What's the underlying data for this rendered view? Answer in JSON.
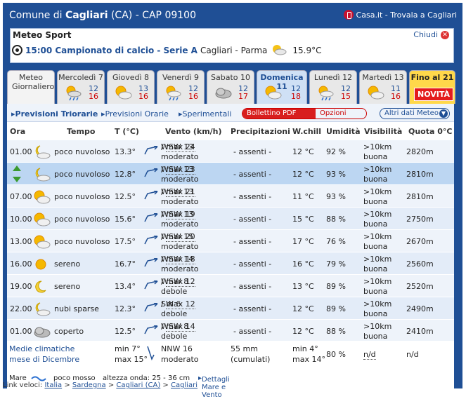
{
  "header": {
    "prefix": "Comune di ",
    "city": "Cagliari",
    "province": " (CA) - CAP 09100",
    "casa_link": "Casa.it - Trovala a Cagliari"
  },
  "sport": {
    "title": "Meteo Sport",
    "close_label": "Chiudi",
    "time_event": "15:00 Campionato di calcio - Serie A",
    "teams": "Cagliari - Parma",
    "temp": "15.9°C"
  },
  "tabs": [
    {
      "label": "Meteo Giornaliero",
      "type": "gior"
    },
    {
      "label": "Mercoledì 7",
      "min": "12",
      "max": "16",
      "icon": "cloud-sun-rain-icon"
    },
    {
      "label": "Giovedì 8",
      "min": "13",
      "max": "16",
      "icon": "sun-cloud-icon"
    },
    {
      "label": "Venerdì 9",
      "min": "12",
      "max": "16",
      "icon": "sun-cloud-rain-icon"
    },
    {
      "label": "Sabato 10",
      "min": "12",
      "max": "17",
      "icon": "cloud-icon"
    },
    {
      "label": "Domenica 11",
      "min": "12",
      "max": "18",
      "icon": "sun-cloud-icon",
      "type": "dom"
    },
    {
      "label": "Lunedì 12",
      "min": "12",
      "max": "15",
      "icon": "sun-cloud-rain-icon"
    },
    {
      "label": "Martedì 13",
      "min": "11",
      "max": "16",
      "icon": "sun-cloud-icon"
    },
    {
      "label": "Fino al 21",
      "badge": "NOVITÀ",
      "type": "fino"
    }
  ],
  "subnav": {
    "items": [
      "Previsioni Triorarie",
      "Previsioni Orarie",
      "Sperimentali"
    ],
    "pdf": "Bollettino PDF",
    "opzioni": "Opzioni",
    "altri": "Altri dati Meteo"
  },
  "columns": [
    "Ora",
    "Tempo",
    "T (°C)",
    "Vento (km/h)",
    "Precipitazioni",
    "W.chill",
    "Umidità",
    "Visibilità",
    "Quota 0°C"
  ],
  "rows": [
    {
      "ora": "01.00",
      "icon": "moon-cloud-icon",
      "tempo": "poco nuvoloso",
      "temp": "13.3°",
      "wind": "WSW 13",
      "wind_max": "max 24",
      "wind_desc": "moderato",
      "prec": "- assenti -",
      "wc": "12 °C",
      "um": "92 %",
      "vis": ">10km",
      "vis_desc": "buona",
      "quota": "2820m"
    },
    {
      "ora": "04.00",
      "icon": "moon-cloud-icon",
      "tempo": "poco nuvoloso",
      "temp": "12.8°",
      "wind": "WSW 13",
      "wind_max": "max 23",
      "wind_desc": "moderato",
      "prec": "- assenti -",
      "wc": "12 °C",
      "um": "93 %",
      "vis": ">10km",
      "vis_desc": "buona",
      "quota": "2810m"
    },
    {
      "ora": "07.00",
      "icon": "sun-cloud-icon",
      "tempo": "poco nuvoloso",
      "temp": "12.5°",
      "wind": "WSW 13",
      "wind_max": "max 21",
      "wind_desc": "moderato",
      "prec": "- assenti -",
      "wc": "11 °C",
      "um": "93 %",
      "vis": ">10km",
      "vis_desc": "buona",
      "quota": "2810m"
    },
    {
      "ora": "10.00",
      "icon": "sun-cloud-icon",
      "tempo": "poco nuvoloso",
      "temp": "15.6°",
      "wind": "WSW 13",
      "wind_max": "max 19",
      "wind_desc": "moderato",
      "prec": "- assenti -",
      "wc": "15 °C",
      "um": "88 %",
      "vis": ">10km",
      "vis_desc": "buona",
      "quota": "2750m"
    },
    {
      "ora": "13.00",
      "icon": "sun-cloud-icon",
      "tempo": "poco nuvoloso",
      "temp": "17.5°",
      "wind": "WSW 15",
      "wind_max": "max 20",
      "wind_desc": "moderato",
      "prec": "- assenti -",
      "wc": "17 °C",
      "um": "76 %",
      "vis": ">10km",
      "vis_desc": "buona",
      "quota": "2670m"
    },
    {
      "ora": "16.00",
      "icon": "sun-icon",
      "tempo": "sereno",
      "temp": "16.7°",
      "wind": "WSW 14",
      "wind_max": "max 18",
      "wind_desc": "moderato",
      "prec": "- assenti -",
      "wc": "16 °C",
      "um": "79 %",
      "vis": ">10km",
      "vis_desc": "buona",
      "quota": "2560m"
    },
    {
      "ora": "19.00",
      "icon": "moon-icon",
      "tempo": "sereno",
      "temp": "13.4°",
      "wind": "WSW 8",
      "wind_max": "max 12",
      "wind_desc": "debole",
      "prec": "- assenti -",
      "wc": "13 °C",
      "um": "89 %",
      "vis": ">10km",
      "vis_desc": "buona",
      "quota": "2520m"
    },
    {
      "ora": "22.00",
      "icon": "moon-cloud-icon",
      "tempo": "nubi sparse",
      "temp": "12.3°",
      "wind": "SW 6",
      "wind_max": "max 12",
      "wind_desc": "debole",
      "prec": "- assenti -",
      "wc": "12 °C",
      "um": "89 %",
      "vis": ">10km",
      "vis_desc": "buona",
      "quota": "2490m"
    },
    {
      "ora": "01.00",
      "icon": "cloud-icon",
      "tempo": "coperto",
      "temp": "12.5°",
      "wind": "WSW 8",
      "wind_max": "max 14",
      "wind_desc": "debole",
      "prec": "- assenti -",
      "wc": "12 °C",
      "um": "88 %",
      "vis": ">10km",
      "vis_desc": "buona",
      "quota": "2410m"
    }
  ],
  "medie": {
    "l1": "Medie climatiche",
    "l2": "mese di Dicembre",
    "tmin": "min 7°",
    "tmax": "max 15°",
    "wind": "NNW 16",
    "wind_desc": "moderato",
    "prec": "55 mm",
    "prec_desc": "(cumulati)",
    "wcmin": "min 4°",
    "wcmax": "max 14°",
    "um": "80 %",
    "vis": "n/d",
    "quota": "n/d"
  },
  "mare": {
    "label": "Mare",
    "state": "poco mosso",
    "onda": "altezza onda: 25 - 36 cm",
    "link": "Dettagli Mare e Vento"
  },
  "footer": {
    "prefix": "Link veloci:",
    "crumbs": [
      "Italia",
      "Sardegna",
      "Cagliari (CA)",
      "Cagliari"
    ]
  },
  "colors": {
    "brand": "#1f4f95",
    "accent": "#c00"
  }
}
